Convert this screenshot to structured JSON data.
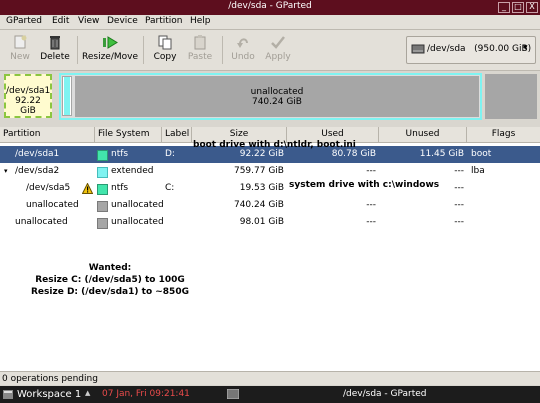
{
  "window": {
    "title": "/dev/sda - GParted",
    "controls": [
      "_",
      "□",
      "X"
    ]
  },
  "menu": [
    "GParted",
    "Edit",
    "View",
    "Device",
    "Partition",
    "Help"
  ],
  "toolbar": {
    "buttons": [
      {
        "label": "New",
        "icon": "new-icon",
        "enabled": false
      },
      {
        "label": "Delete",
        "icon": "delete-icon",
        "enabled": true
      },
      {
        "label": "Resize/Move",
        "icon": "resize-move-icon",
        "enabled": true
      },
      {
        "label": "Copy",
        "icon": "copy-icon",
        "enabled": true
      },
      {
        "label": "Paste",
        "icon": "paste-icon",
        "enabled": false
      },
      {
        "label": "Undo",
        "icon": "undo-icon",
        "enabled": false
      },
      {
        "label": "Apply",
        "icon": "apply-icon",
        "enabled": false
      }
    ],
    "device": "/dev/sda   (950.00 GiB)"
  },
  "graph": {
    "p1_name": "/dev/sda1",
    "p1_size": "92.22 GiB",
    "unalloc_label": "unallocated",
    "unalloc_size": "740.24 GiB"
  },
  "columns": [
    "Partition",
    "File System",
    "Label",
    "Size",
    "Used",
    "Unused",
    "Flags"
  ],
  "rows": [
    {
      "partition": "/dev/sda1",
      "fs": "ntfs",
      "color": "#42e5ac",
      "label": "D:",
      "size": "92.22 GiB",
      "used": "80.78 GiB",
      "unused": "11.45 GiB",
      "flags": "boot",
      "selected": true
    },
    {
      "partition": "/dev/sda2",
      "fs": "extended",
      "color": "#7ff3f1",
      "label": "",
      "size": "759.77 GiB",
      "used": "---",
      "unused": "---",
      "flags": "lba",
      "selected": false
    },
    {
      "partition": "/dev/sda5",
      "fs": "ntfs",
      "color": "#42e5ac",
      "label": "C:",
      "size": "19.53 GiB",
      "used": "---",
      "unused": "---",
      "flags": "",
      "selected": false,
      "warning": true
    },
    {
      "partition": "unallocated",
      "fs": "unallocated",
      "color": "#a6a6a6",
      "label": "",
      "size": "740.24 GiB",
      "used": "---",
      "unused": "---",
      "flags": "",
      "selected": false
    },
    {
      "partition": "unallocated",
      "fs": "unallocated",
      "color": "#a6a6a6",
      "label": "",
      "size": "98.01 GiB",
      "used": "---",
      "unused": "---",
      "flags": "",
      "selected": false
    }
  ],
  "annotations": {
    "sda1_note": "boot drive with d:\\ntldr, boot.ini",
    "sda5_note": "system drive with c:\\windows",
    "wanted_title": "Wanted:",
    "wanted_line1": "Resize C: (/dev/sda5) to 100G",
    "wanted_line2": "Resize D: (/dev/sda1) to ~850G"
  },
  "status": "0 operations pending",
  "taskbar": {
    "workspace": "Workspace 1",
    "clock": "07 Jan, Fri 09:21:41",
    "window_item": "/dev/sda - GParted"
  }
}
